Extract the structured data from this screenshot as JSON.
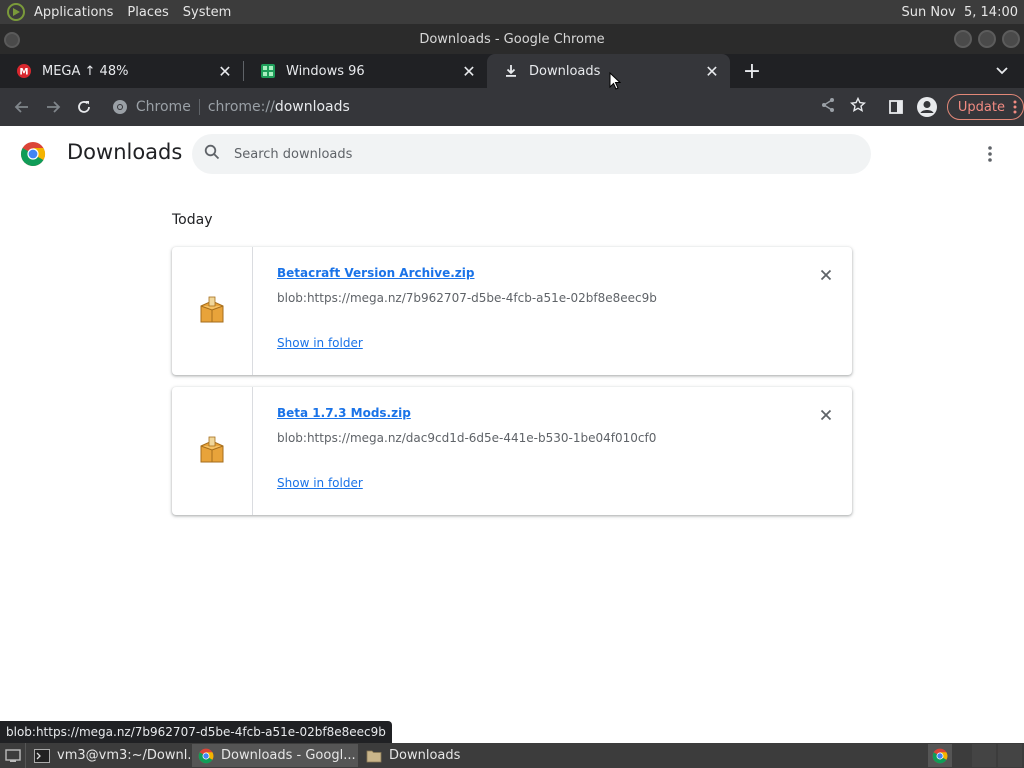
{
  "top_panel": {
    "menus": [
      "Applications",
      "Places",
      "System"
    ],
    "clock": "Sun Nov  5, 14:00"
  },
  "window": {
    "title": "Downloads - Google Chrome"
  },
  "tabs": [
    {
      "title": "MEGA ↑ 48%",
      "icon": "mega-icon"
    },
    {
      "title": "Windows 96",
      "icon": "windows96-icon"
    },
    {
      "title": "Downloads",
      "icon": "download-icon",
      "active": true
    }
  ],
  "toolbar": {
    "site_chip": "Chrome",
    "url_scheme": "chrome://",
    "url_host": "downloads",
    "update_label": "Update"
  },
  "downloads_page": {
    "title": "Downloads",
    "search_placeholder": "Search downloads",
    "section_date": "Today",
    "items": [
      {
        "file_name": "Betacraft Version Archive.zip",
        "url": "blob:https://mega.nz/7b962707-d5be-4fcb-a51e-02bf8e8eec9b",
        "action": "Show in folder"
      },
      {
        "file_name": "Beta 1.7.3 Mods.zip",
        "url": "blob:https://mega.nz/dac9cd1d-6d5e-441e-b530-1be04f010cf0",
        "action": "Show in folder"
      }
    ]
  },
  "status_bubble": "blob:https://mega.nz/7b962707-d5be-4fcb-a51e-02bf8e8eec9b",
  "taskbar": {
    "tasks": [
      {
        "label": "vm3@vm3:~/Downl...",
        "icon": "terminal-icon"
      },
      {
        "label": "Downloads - Googl...",
        "icon": "chrome-icon",
        "active": true
      },
      {
        "label": "Downloads",
        "icon": "folder-icon"
      }
    ]
  },
  "colors": {
    "link": "#1a73e8",
    "update_accent": "#f28b82",
    "tab_strip": "#202124",
    "toolbar": "#35363a"
  }
}
